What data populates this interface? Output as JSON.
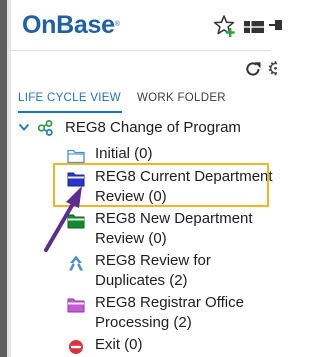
{
  "app": {
    "logo": "OnBase",
    "logo_mark": "®"
  },
  "tabs": [
    {
      "label": "LIFE CYCLE VIEW",
      "active": true
    },
    {
      "label": "WORK FOLDER",
      "active": false
    }
  ],
  "tree": {
    "root": {
      "label": "REG8 Change of Program",
      "expanded": true
    },
    "queues": [
      {
        "label": "Initial (0)",
        "icon": "folder-outline-icon"
      },
      {
        "label": "REG8 Current Department\nReview (0)",
        "icon": "blue-folder-icon",
        "highlighted": true
      },
      {
        "label": "REG8 New Department\nReview (0)",
        "icon": "green-folder-icon"
      },
      {
        "label": "REG8 Review for\nDuplicates (2)",
        "icon": "load-balance-icon"
      },
      {
        "label": "REG8 Registrar Office\nProcessing (2)",
        "icon": "purple-folder-icon"
      },
      {
        "label": "Exit (0)",
        "icon": "exit-icon"
      }
    ]
  },
  "colors": {
    "accent": "#1e73c6",
    "logo": "#1f5fa6",
    "highlight_border": "#f0b429",
    "annotation_arrow": "#5b2d8e"
  }
}
